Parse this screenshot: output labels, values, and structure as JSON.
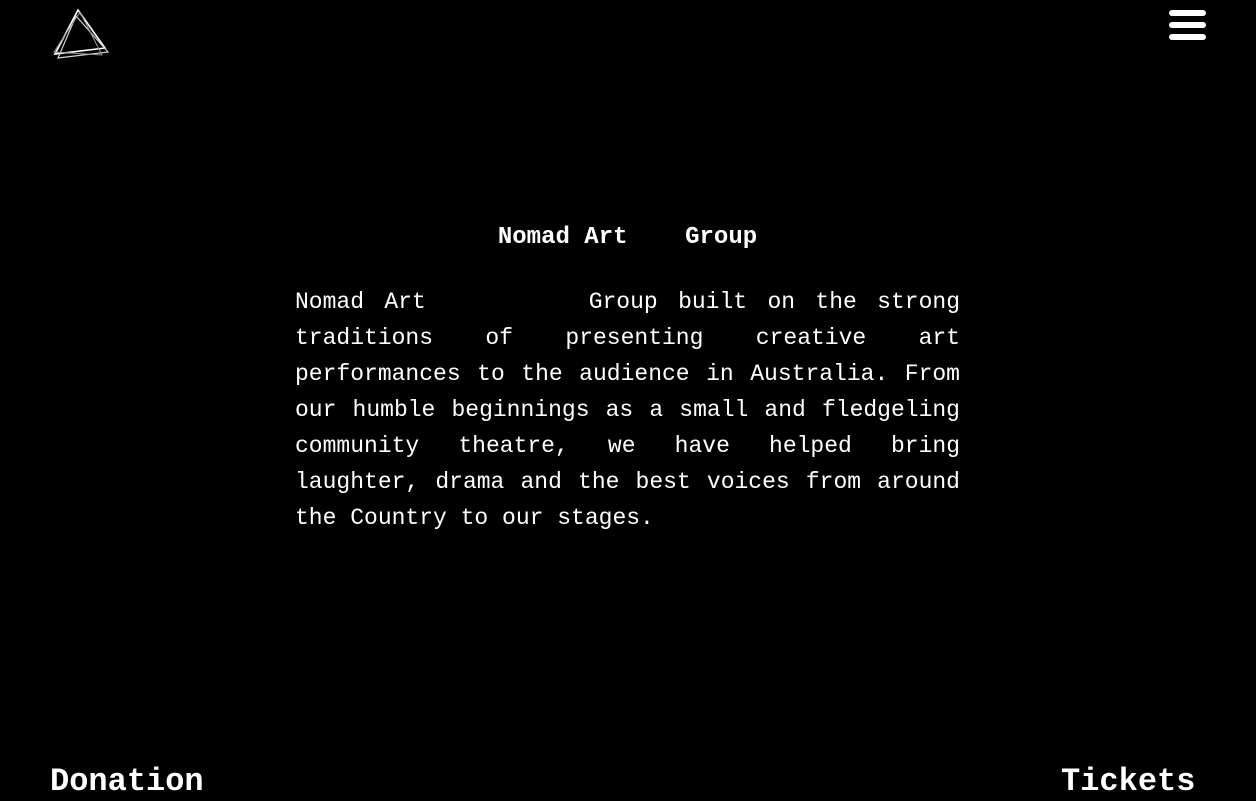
{
  "header": {
    "logo_icon": "triangle-logo-icon",
    "menu_icon": "hamburger-menu-icon"
  },
  "main": {
    "title": "Nomad Art    Group",
    "description": "Nomad Art        Group built on the strong traditions of presenting creative art performances to the audience in Australia. From our humble beginnings as a small and fledgeling community theatre, we have helped bring laughter, drama and the best voices from around the Country to our stages."
  },
  "footer": {
    "donation_label": "Donation",
    "tickets_label": "Tickets"
  },
  "colors": {
    "background": "#000000",
    "text": "#ffffff"
  }
}
